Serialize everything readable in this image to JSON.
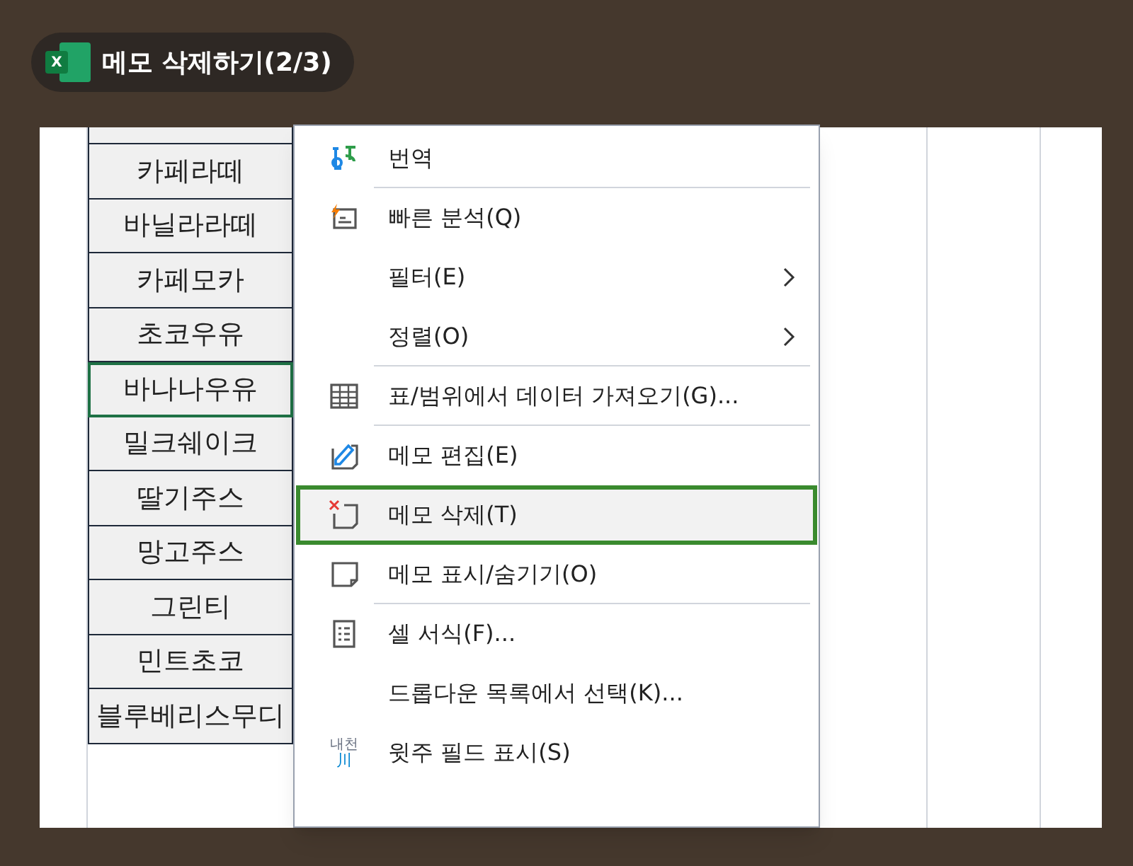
{
  "title": {
    "logo_text": "X",
    "text": "메모 삭제하기(2/3)"
  },
  "cells": [
    {
      "text": "카페라떼",
      "selected": false
    },
    {
      "text": "바닐라라떼",
      "selected": false
    },
    {
      "text": "카페모카",
      "selected": false
    },
    {
      "text": "초코우유",
      "selected": false
    },
    {
      "text": "바나나우유",
      "selected": true
    },
    {
      "text": "밀크쉐이크",
      "selected": false
    },
    {
      "text": "딸기주스",
      "selected": false
    },
    {
      "text": "망고주스",
      "selected": false
    },
    {
      "text": "그린티",
      "selected": false
    },
    {
      "text": "민트초코",
      "selected": false
    },
    {
      "text": "블루베리스무디",
      "selected": false
    }
  ],
  "menu": [
    {
      "label": "번역",
      "selected": false,
      "submenu": false,
      "divider_after": true
    },
    {
      "label": "빠른 분석(Q)",
      "selected": false,
      "submenu": false,
      "divider_after": false
    },
    {
      "label": "필터(E)",
      "selected": false,
      "submenu": true,
      "divider_after": false
    },
    {
      "label": "정렬(O)",
      "selected": false,
      "submenu": true,
      "divider_after": true
    },
    {
      "label": "표/범위에서 데이터 가져오기(G)...",
      "selected": false,
      "submenu": false,
      "divider_after": true
    },
    {
      "label": "메모 편집(E)",
      "selected": false,
      "submenu": false,
      "divider_after": false
    },
    {
      "label": "메모 삭제(T)",
      "selected": true,
      "submenu": false,
      "divider_after": false
    },
    {
      "label": "메모 표시/숨기기(O)",
      "selected": false,
      "submenu": false,
      "divider_after": true
    },
    {
      "label": "셀 서식(F)...",
      "selected": false,
      "submenu": false,
      "divider_after": false
    },
    {
      "label": "드롭다운 목록에서 선택(K)...",
      "selected": false,
      "submenu": false,
      "divider_after": false
    },
    {
      "label": "윗주 필드 표시(S)",
      "selected": false,
      "submenu": false,
      "divider_after": false,
      "icon_text": [
        "내천",
        "川"
      ]
    }
  ]
}
